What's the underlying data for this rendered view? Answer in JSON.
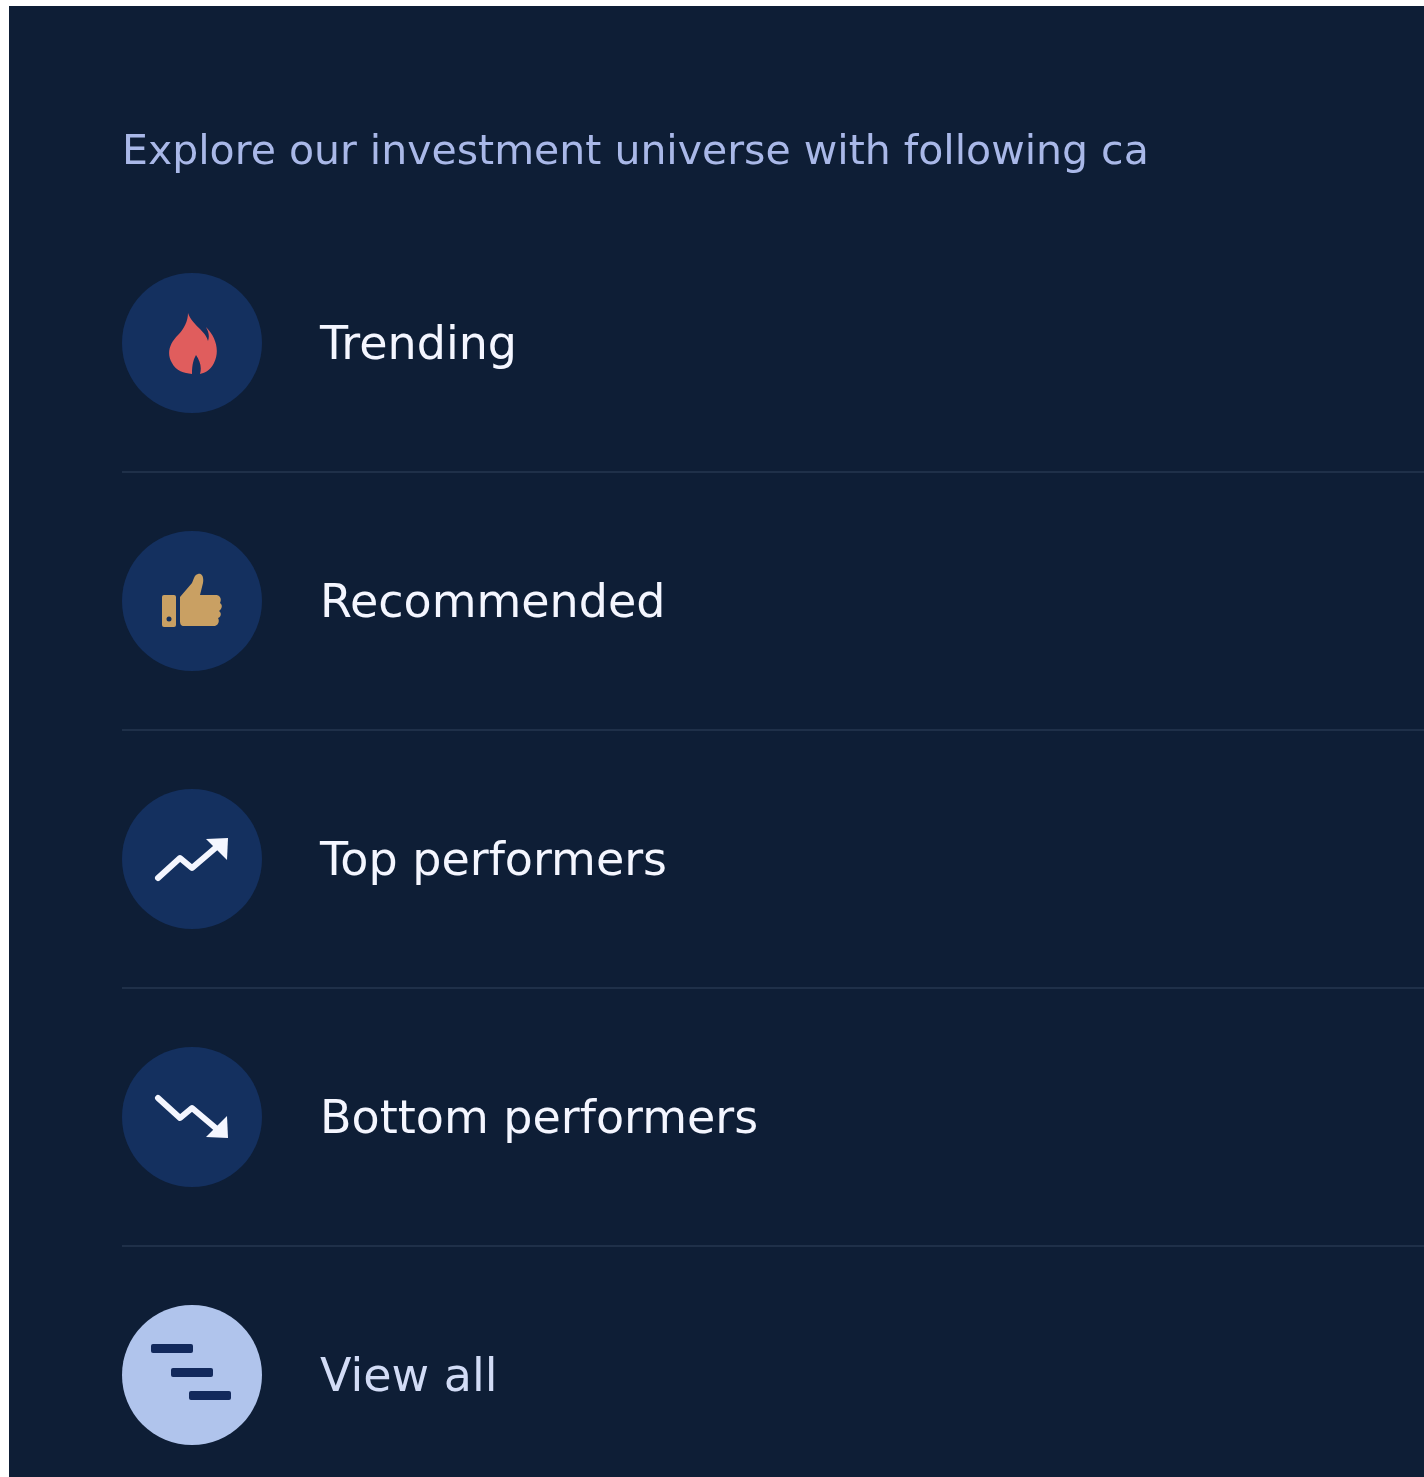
{
  "heading": "Explore our investment universe with following ca",
  "categories": [
    {
      "kind": "trending",
      "label": "Trending"
    },
    {
      "kind": "recommended",
      "label": "Recommended"
    },
    {
      "kind": "top",
      "label": "Top performers"
    },
    {
      "kind": "bottom",
      "label": "Bottom performers"
    },
    {
      "kind": "all",
      "label": "View all"
    }
  ]
}
